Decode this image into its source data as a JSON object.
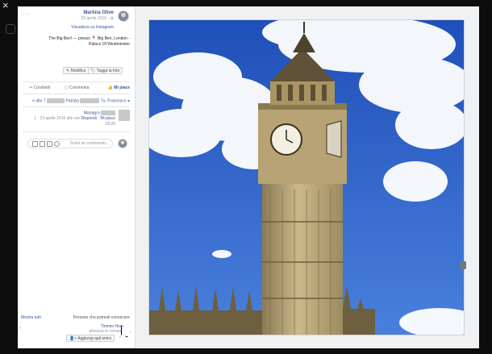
{
  "window": {
    "close_glyph": "×"
  },
  "post": {
    "author": "Martina Olive",
    "date": "23 aprile 2016 ·",
    "instagram_link": "Visualizza su Instagram",
    "caption_line1": "The Big Ben! — presso 📍 Big Ben, London -",
    "caption_line2": "Palace Of Westminster"
  },
  "buttons": {
    "tag_photo": "Tagga la foto",
    "edit": "Modifica"
  },
  "actions": {
    "like": "Mi piace",
    "comment": "Commenta",
    "share": "Condividi"
  },
  "reactions": {
    "prefix": "Tu, Francesco",
    "middle": "Patrizia",
    "suffix": "e altri 7"
  },
  "comment": {
    "author_suffix": "Mariagra",
    "like_link": "Mi piace",
    "reply_link": "Rispondi",
    "meta": "· 1 · 23 aprile 2016 alle ore",
    "time": "18:28"
  },
  "comment_input": {
    "placeholder": "Scrivi un commento..."
  },
  "suggestions": {
    "title": "Persone che potresti conoscere",
    "show_all": "Mostra tutti",
    "person_name": "Timmie Hom",
    "mutual": "amicizia in comune",
    "add_friend": "Aggiungi agli amici"
  },
  "colors": {
    "link_blue": "#365899",
    "sky": "#2f63c9",
    "panel_bg": "#ffffff"
  }
}
